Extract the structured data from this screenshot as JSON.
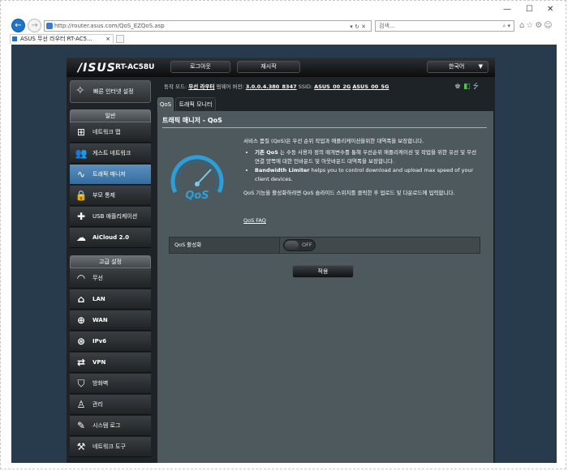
{
  "browser": {
    "address": "http://router.asus.com/QoS_EZQoS.asp",
    "search_placeholder": "검색...",
    "tab_title": "ASUS 무선 라우터 RT-AC5...",
    "window_controls": [
      "—",
      "☐",
      "✕"
    ]
  },
  "router": {
    "logo": "/ISUS",
    "model": "RT-AC58U",
    "logout": "로그아웃",
    "reboot": "재시작",
    "language": "한국어"
  },
  "status": {
    "mode_label": "동작 모드:",
    "mode_value": "무선 라우터",
    "firmware_label": "펌웨어 버전:",
    "firmware_value": "3.0.0.4.380_8347",
    "ssid_label": "SSID:",
    "ssid_1": "ASUS_00_2G",
    "ssid_2": "ASUS_00_5G"
  },
  "sidebar": {
    "quick_setup": "빠른 인터넷 설정",
    "general_header": "일반",
    "general": [
      {
        "label": "네트워크 맵",
        "icon": "network-map-icon"
      },
      {
        "label": "게스트 네트워크",
        "icon": "guest-network-icon"
      },
      {
        "label": "트래픽 매니저",
        "icon": "traffic-manager-icon"
      },
      {
        "label": "부모 통제",
        "icon": "parental-control-icon"
      },
      {
        "label": "USB 애플리케이션",
        "icon": "usb-application-icon"
      },
      {
        "label": "AiCloud 2.0",
        "icon": "aicloud-icon"
      }
    ],
    "advanced_header": "고급 설정",
    "advanced": [
      {
        "label": "무선",
        "icon": "wireless-icon"
      },
      {
        "label": "LAN",
        "icon": "lan-icon"
      },
      {
        "label": "WAN",
        "icon": "wan-icon"
      },
      {
        "label": "IPv6",
        "icon": "ipv6-icon"
      },
      {
        "label": "VPN",
        "icon": "vpn-icon"
      },
      {
        "label": "방화벽",
        "icon": "firewall-icon"
      },
      {
        "label": "관리",
        "icon": "administration-icon"
      },
      {
        "label": "시스템 로그",
        "icon": "system-log-icon"
      },
      {
        "label": "네트워크 도구",
        "icon": "network-tools-icon"
      }
    ]
  },
  "content": {
    "tab_qos": "QoS",
    "tab_monitor": "트래픽 모니터",
    "title": "트래픽 매니저 - QoS",
    "intro": "서비스 품질 (QoS)은 우선 순위 작업과 애플리케이션을위한 대역폭을 보장합니다.",
    "bullet1_bold": "기존 QoS",
    "bullet1_text": " 는 수동 사용자 정의 매개변수를 통해 우선순위 애플리케이션 및 작업을 위한 유선 및 무선 연결 양쪽에 대한 인바운드 및 아웃바운드 대역폭을 보장합니다.",
    "bullet2_bold": "Bandwidth Limiter",
    "bullet2_text": " helps you to control download and upload max speed of your client devices.",
    "enable_hint": "QoS 기능을 활성화하려면 QoS 슬라이드 스위치를 클릭한 후 업로드 및 다운로드에 입력합니다.",
    "faq": "QoS FAQ",
    "gauge_text": "QoS",
    "enable_label": "QoS 활성화",
    "switch_state": "OFF",
    "apply": "적용"
  }
}
